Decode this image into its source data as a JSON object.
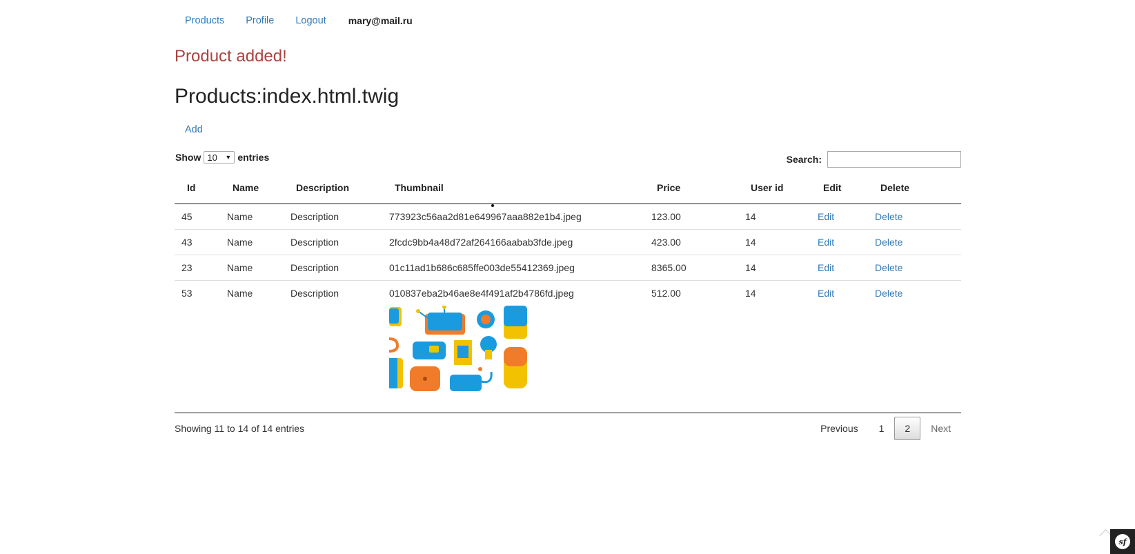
{
  "nav": {
    "items": [
      "Products",
      "Profile",
      "Logout"
    ],
    "user": "mary@mail.ru"
  },
  "flash": "Product added!",
  "page_title": "Products:index.html.twig",
  "add_label": "Add",
  "length": {
    "prefix": "Show",
    "value": "10",
    "suffix": "entries"
  },
  "search": {
    "label": "Search:",
    "value": ""
  },
  "table": {
    "columns": [
      "Id",
      "Name",
      "Description",
      "Thumbnail",
      "Price",
      "User id",
      "Edit",
      "Delete"
    ],
    "rows": [
      {
        "id": "45",
        "name": "Name",
        "description": "Description",
        "thumbnail": "773923c56aa2d81e649967aaa882e1b4.jpeg",
        "price": "123.00",
        "user_id": "14",
        "edit": "Edit",
        "delete": "Delete"
      },
      {
        "id": "43",
        "name": "Name",
        "description": "Description",
        "thumbnail": "2fcdc9bb4a48d72af264166aabab3fde.jpeg",
        "price": "423.00",
        "user_id": "14",
        "edit": "Edit",
        "delete": "Delete"
      },
      {
        "id": "23",
        "name": "Name",
        "description": "Description",
        "thumbnail": "01c11ad1b686c685ffe003de55412369.jpeg",
        "price": "8365.00",
        "user_id": "14",
        "edit": "Edit",
        "delete": "Delete"
      },
      {
        "id": "53",
        "name": "Name",
        "description": "Description",
        "thumbnail": "010837eba2b46ae8e4f491af2b4786fd.jpeg",
        "price": "512.00",
        "user_id": "14",
        "edit": "Edit",
        "delete": "Delete"
      }
    ]
  },
  "info": "Showing 11 to 14 of 14 entries",
  "pagination": {
    "previous": "Previous",
    "pages": [
      "1",
      "2"
    ],
    "current": "2",
    "next": "Next"
  },
  "colors": {
    "link": "#337ab7",
    "flash": "#a94442"
  }
}
